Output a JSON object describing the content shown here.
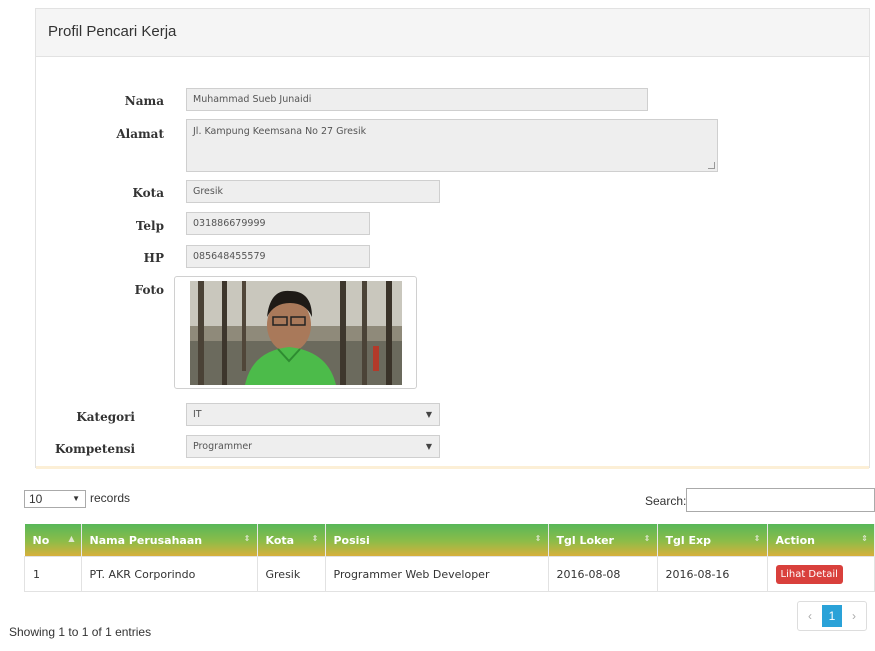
{
  "panel": {
    "title": "Profil Pencari Kerja"
  },
  "form": {
    "nama_label": "Nama",
    "nama_value": "Muhammad Sueb Junaidi",
    "alamat_label": "Alamat",
    "alamat_value": "Jl. Kampung Keemsana No 27 Gresik",
    "kota_label": "Kota",
    "kota_value": "Gresik",
    "telp_label": "Telp",
    "telp_value": "031886679999",
    "hp_label": "HP",
    "hp_value": "085648455579",
    "foto_label": "Foto",
    "kategori_label": "Kategori",
    "kategori_value": "IT",
    "kompetensi_label": "Kompetensi",
    "kompetensi_value": "Programmer"
  },
  "table_controls": {
    "length_value": "10",
    "records_label": "records",
    "search_label": "Search:"
  },
  "table": {
    "headers": [
      "No",
      "Nama Perusahaan",
      "Kota",
      "Posisi",
      "Tgl Loker",
      "Tgl Exp",
      "Action"
    ],
    "rows": [
      {
        "no": "1",
        "perusahaan": "PT. AKR Corporindo",
        "kota": "Gresik",
        "posisi": "Programmer Web Developer",
        "tgl_loker": "2016-08-08",
        "tgl_exp": "2016-08-16",
        "action": "Lihat Detail"
      }
    ]
  },
  "footer": {
    "info": "Showing 1 to 1 of 1 entries",
    "pager_prev": "‹",
    "pager_current": "1",
    "pager_next": "›"
  },
  "colors": {
    "header_gradient_top": "#58b75a",
    "header_gradient_bottom": "#d6b03c",
    "detail_button": "#d9403c",
    "pager_active": "#2aa2d8"
  }
}
